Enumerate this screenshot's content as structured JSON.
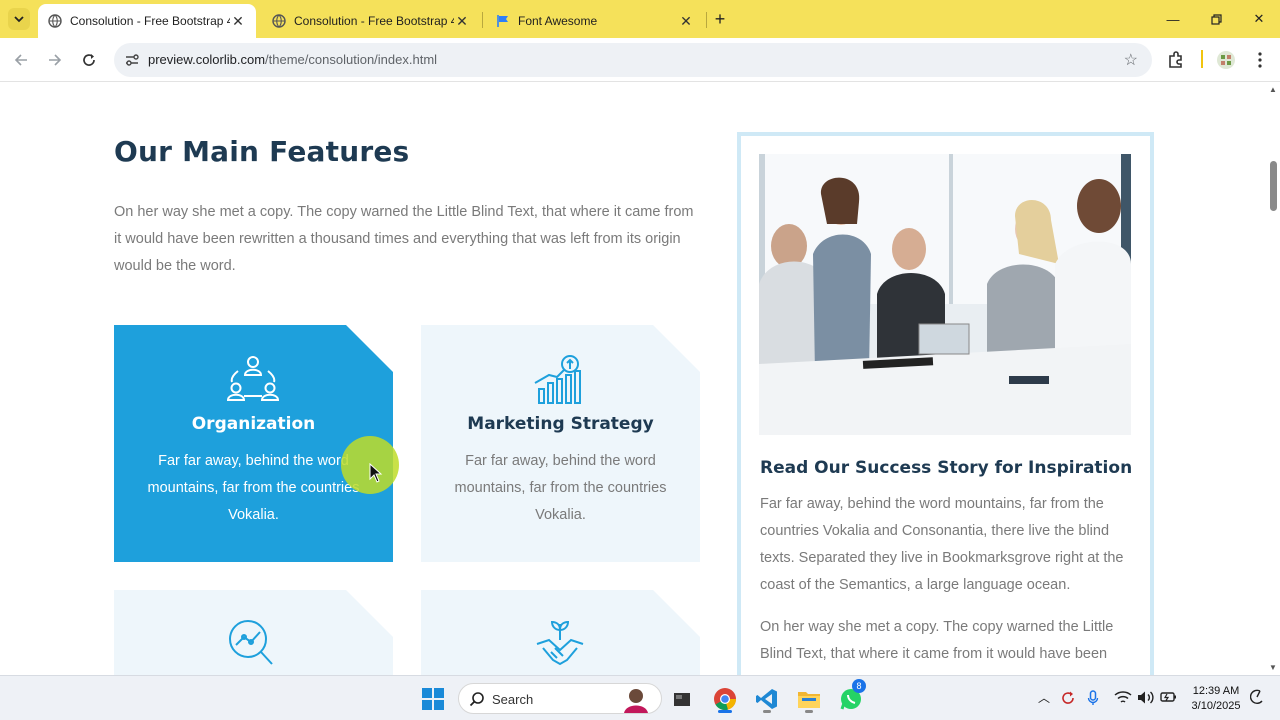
{
  "browser": {
    "tabs": [
      {
        "title": "Consolution - Free Bootstrap 4",
        "active": true
      },
      {
        "title": "Consolution - Free Bootstrap 4",
        "active": false
      },
      {
        "title": "Font Awesome",
        "active": false
      }
    ],
    "url_host": "preview.colorlib.com",
    "url_path": "/theme/consolution/index.html"
  },
  "page": {
    "features_title": "Our Main Features",
    "features_intro": "On her way she met a copy. The copy warned the Little Blind Text, that where it came from it would have been rewritten a thousand times and everything that was left from its origin would be the word.",
    "cards": [
      {
        "title": "Organization",
        "desc": "Far far away, behind the word mountains, far from the countries Vokalia.",
        "icon": "organization-icon"
      },
      {
        "title": "Marketing Strategy",
        "desc": "Far far away, behind the word mountains, far from the countries Vokalia.",
        "icon": "growth-chart-icon"
      }
    ],
    "lower_card_icons": [
      "search-chart-icon",
      "plant-handshake-icon"
    ],
    "story": {
      "title": "Read Our Success Story for Inspiration",
      "para1": "Far far away, behind the word mountains, far from the countries Vokalia and Consonantia, there live the blind texts. Separated they live in Bookmarksgrove right at the coast of the Semantics, a large language ocean.",
      "para2": "On her way she met a copy. The copy warned the Little Blind Text, that where it came from it would have been"
    },
    "accent_color": "#1ea0dc",
    "heading_color": "#1e3a52"
  },
  "taskbar": {
    "search_label": "Search",
    "whatsapp_badge": "8",
    "time": "12:39 AM",
    "date": "3/10/2025"
  }
}
